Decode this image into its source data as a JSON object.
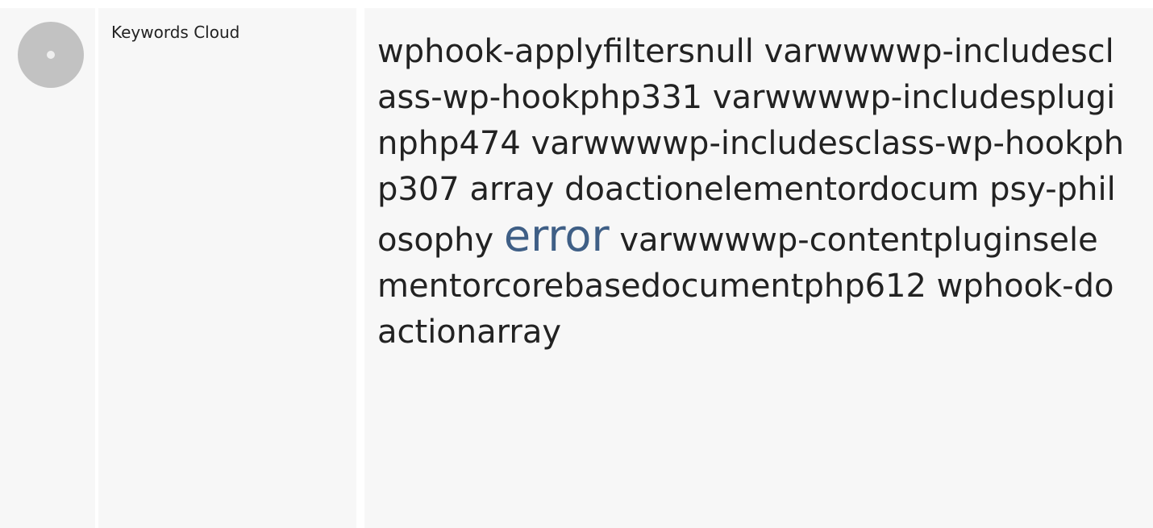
{
  "section": {
    "label": "Keywords Cloud",
    "icon": "disc-icon",
    "colors": {
      "background": "#f7f7f7",
      "icon_gray": "#c2c2c2",
      "highlight": "#3f5f86",
      "text": "#222222"
    }
  },
  "keywords": [
    "wphook-applyfiltersnull varwwwwp-includesclass-wp-hookphp331",
    "varwwwwp-includespluginphp474",
    "varwwwwp-includesclass-wp-hookphp307",
    "array doactionelementordocum",
    "psy-philosophy",
    "error",
    "varwwwwp-contentpluginselementorcorebasedocumentphp612",
    "wphook-doactionarray"
  ]
}
